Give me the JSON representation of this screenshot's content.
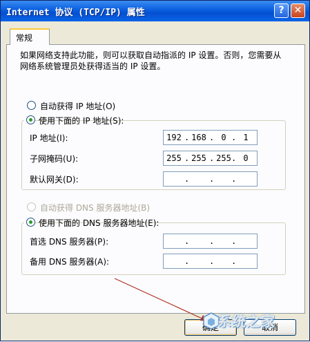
{
  "window": {
    "title": "Internet 协议 (TCP/IP) 属性",
    "help_glyph": "?",
    "close_glyph": "✕"
  },
  "tabs": [
    {
      "label": "常规",
      "selected": true
    }
  ],
  "description": "如果网络支持此功能，则可以获取自动指派的 IP 设置。否则，您需要从网络系统管理员处获得适当的 IP 设置。",
  "ip_mode": {
    "auto_label": "自动获得 IP 地址(O)",
    "manual_label": "使用下面的 IP 地址(S):",
    "selected": "manual"
  },
  "ip_fields": [
    {
      "label": "IP 地址(I):",
      "value": [
        "192",
        "168",
        "0",
        "1"
      ]
    },
    {
      "label": "子网掩码(U):",
      "value": [
        "255",
        "255",
        "255",
        "0"
      ]
    },
    {
      "label": "默认网关(D):",
      "value": [
        "",
        "",
        "",
        ""
      ]
    }
  ],
  "dns_mode": {
    "auto_label": "自动获得 DNS 服务器地址(B)",
    "auto_disabled": true,
    "manual_label": "使用下面的 DNS 服务器地址(E):",
    "selected": "manual"
  },
  "dns_fields": [
    {
      "label": "首选 DNS 服务器(P):",
      "value": [
        "",
        "",
        "",
        ""
      ]
    },
    {
      "label": "备用 DNS 服务器(A):",
      "value": [
        "",
        "",
        "",
        ""
      ]
    }
  ],
  "buttons": {
    "ok": "确定",
    "cancel": "取消"
  },
  "watermark": {
    "text": "系统之家"
  },
  "colors": {
    "titlebar": "#0a5ee0",
    "panel": "#ece9d8",
    "annotation_arrow": "#b03020"
  }
}
